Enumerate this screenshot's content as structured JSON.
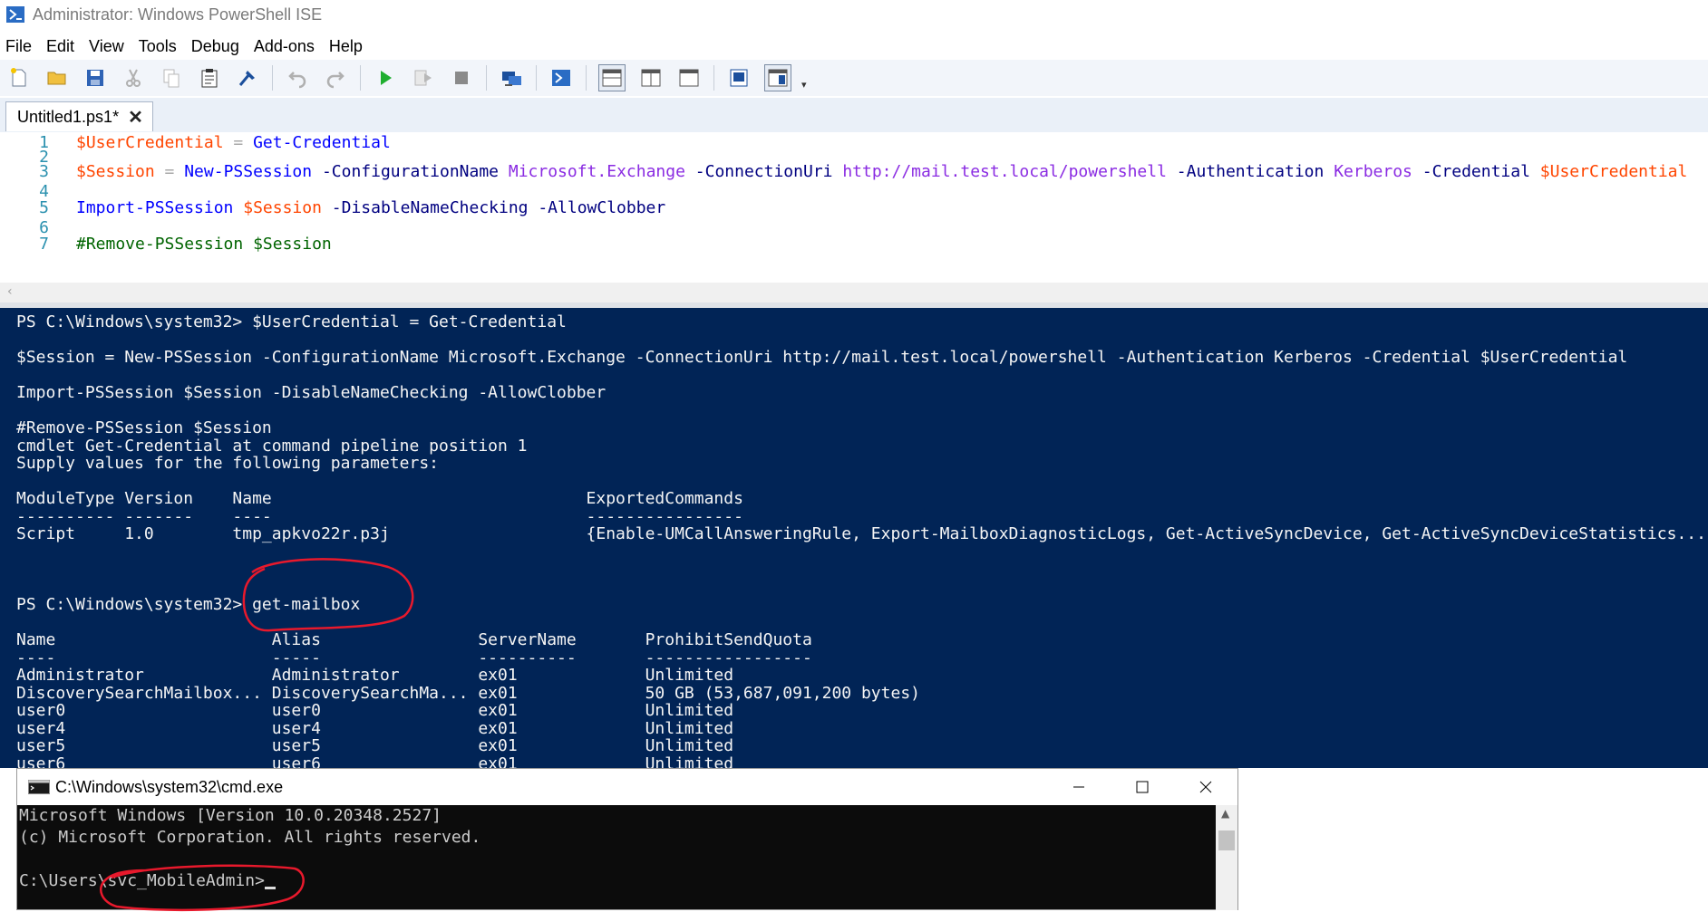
{
  "window": {
    "title": "Administrator: Windows PowerShell ISE"
  },
  "menu": [
    "File",
    "Edit",
    "View",
    "Tools",
    "Debug",
    "Add-ons",
    "Help"
  ],
  "toolbar": {
    "icons": [
      "new-file-icon",
      "open-folder-icon",
      "save-icon",
      "cut-icon",
      "copy-icon",
      "paste-icon",
      "clear-console-icon",
      "undo-icon",
      "redo-icon",
      "run-script-icon",
      "run-selection-icon",
      "stop-icon",
      "new-remote-tab-icon",
      "start-powershell-icon",
      "show-script-top-icon",
      "show-script-right-icon",
      "show-script-max-icon",
      "show-command-window-icon",
      "show-command-addon-icon",
      "toolbar-overflow-icon"
    ]
  },
  "tab": {
    "label": "Untitled1.ps1*",
    "close": "✕"
  },
  "editor": {
    "lines": [
      {
        "num": "1",
        "tokens": [
          {
            "t": "$UserCredential",
            "c": "var"
          },
          {
            "t": " = ",
            "c": "op"
          },
          {
            "t": "Get-Credential",
            "c": "cmd"
          }
        ]
      },
      {
        "num": "2",
        "tokens": []
      },
      {
        "num": "3",
        "tokens": [
          {
            "t": "$Session",
            "c": "var"
          },
          {
            "t": " = ",
            "c": "op"
          },
          {
            "t": "New-PSSession",
            "c": "cmd"
          },
          {
            "t": " -ConfigurationName ",
            "c": "param"
          },
          {
            "t": "Microsoft.Exchange",
            "c": "arg"
          },
          {
            "t": " -ConnectionUri ",
            "c": "param"
          },
          {
            "t": "http://mail.test.local/powershell",
            "c": "arg"
          },
          {
            "t": " -Authentication ",
            "c": "param"
          },
          {
            "t": "Kerberos",
            "c": "arg"
          },
          {
            "t": " -Credential ",
            "c": "param"
          },
          {
            "t": "$UserCredential",
            "c": "var"
          }
        ]
      },
      {
        "num": "4",
        "tokens": []
      },
      {
        "num": "5",
        "tokens": [
          {
            "t": "Import-PSSession",
            "c": "cmd"
          },
          {
            "t": " ",
            "c": "op"
          },
          {
            "t": "$Session",
            "c": "var"
          },
          {
            "t": " -DisableNameChecking -AllowClobber",
            "c": "param"
          }
        ]
      },
      {
        "num": "6",
        "tokens": []
      },
      {
        "num": "7",
        "tokens": [
          {
            "t": "#Remove-PSSession $Session",
            "c": "cmt"
          }
        ]
      }
    ]
  },
  "console": {
    "lines": [
      "PS C:\\Windows\\system32> $UserCredential = Get-Credential",
      "",
      "$Session = New-PSSession -ConfigurationName Microsoft.Exchange -ConnectionUri http://mail.test.local/powershell -Authentication Kerberos -Credential $UserCredential",
      "",
      "Import-PSSession $Session -DisableNameChecking -AllowClobber",
      "",
      "#Remove-PSSession $Session",
      "cmdlet Get-Credential at command pipeline position 1",
      "Supply values for the following parameters:",
      "",
      "ModuleType Version    Name                                ExportedCommands",
      "---------- -------    ----                                ----------------",
      "Script     1.0        tmp_apkvo22r.p3j                    {Enable-UMCallAnsweringRule, Export-MailboxDiagnosticLogs, Get-ActiveSyncDevice, Get-ActiveSyncDeviceStatistics...",
      "",
      "",
      "",
      "PS C:\\Windows\\system32> get-mailbox",
      "",
      "Name                      Alias                ServerName       ProhibitSendQuota",
      "----                      -----                ----------       -----------------",
      "Administrator             Administrator        ex01             Unlimited",
      "DiscoverySearchMailbox... DiscoverySearchMa... ex01             50 GB (53,687,091,200 bytes)",
      "user0                     user0                ex01             Unlimited",
      "user4                     user4                ex01             Unlimited",
      "user5                     user5                ex01             Unlimited",
      "user6                     user6                ex01             Unlimited"
    ]
  },
  "cmd_window": {
    "title": "C:\\Windows\\system32\\cmd.exe",
    "lines": [
      "Microsoft Windows [Version 10.0.20348.2527]",
      "(c) Microsoft Corporation. All rights reserved.",
      "",
      "C:\\Users\\svc_MobileAdmin>"
    ]
  },
  "colors": {
    "console_bg": "#012456",
    "annotation": "#e8192c"
  }
}
